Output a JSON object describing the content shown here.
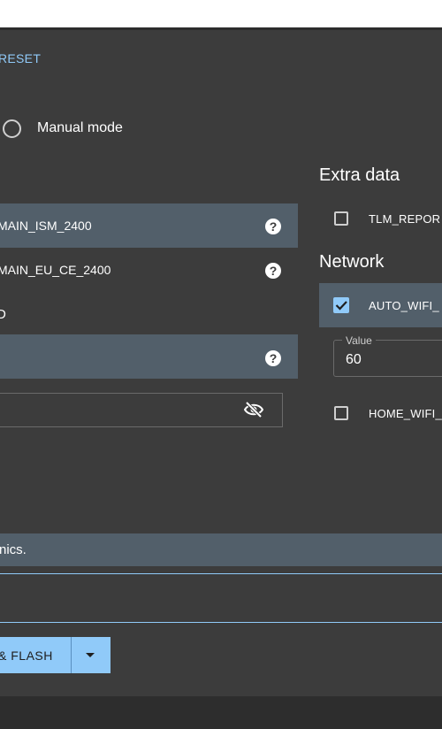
{
  "header": {
    "reset_label": "RESET"
  },
  "mode": {
    "manual_label": "Manual mode"
  },
  "regulatory": {
    "options": [
      {
        "label": "MAIN_ISM_2400",
        "help": "?"
      },
      {
        "label": "MAIN_EU_CE_2400",
        "help": "?"
      }
    ],
    "partial_label": "D",
    "blank_row_help": "?"
  },
  "password": {
    "visibility_icon": "eye-off-icon"
  },
  "extra_data": {
    "heading": "Extra data",
    "items": [
      {
        "label": "TLM_REPOR",
        "checked": false
      }
    ]
  },
  "network": {
    "heading": "Network",
    "items": [
      {
        "label": "AUTO_WIFI_",
        "checked": true
      },
      {
        "label": "HOME_WIFI_",
        "checked": false
      }
    ],
    "value_field": {
      "legend": "Value",
      "value": "60"
    }
  },
  "notice": {
    "text": "nics."
  },
  "actions": {
    "flash_label": "& FLASH",
    "dropdown_icon": "caret-down-icon"
  },
  "colors": {
    "accent": "#90caf9",
    "background": "#3c3c3c",
    "row_highlight": "#525f6a"
  }
}
